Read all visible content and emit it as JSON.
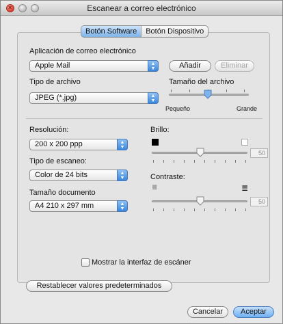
{
  "window": {
    "title": "Escanear a correo electrónico"
  },
  "tabs": [
    {
      "label": "Botón Software",
      "active": true
    },
    {
      "label": "Botón Dispositivo",
      "active": false
    }
  ],
  "email_app": {
    "label": "Aplicación de correo electrónico",
    "value": "Apple Mail",
    "add_label": "Añadir",
    "remove_label": "Eliminar"
  },
  "file_type": {
    "label": "Tipo de archivo",
    "value": "JPEG (*.jpg)"
  },
  "file_size": {
    "label": "Tamaño del archivo",
    "min_label": "Pequeño",
    "max_label": "Grande"
  },
  "resolution": {
    "label": "Resolución:",
    "value": "200 x 200 ppp"
  },
  "scan_type": {
    "label": "Tipo de escaneo:",
    "value": "Color de 24 bits"
  },
  "doc_size": {
    "label": "Tamaño documento",
    "value": "A4  210 x 297 mm"
  },
  "brightness": {
    "label": "Brillo:",
    "value": "50"
  },
  "contrast": {
    "label": "Contraste:",
    "value": "50"
  },
  "show_interface": {
    "label": "Mostrar la interfaz de escáner",
    "checked": false
  },
  "restore_defaults_label": "Restablecer valores predeterminados",
  "footer": {
    "cancel_label": "Cancelar",
    "accept_label": "Aceptar"
  },
  "colors": {
    "accent": "#5fa8f0",
    "window_bg": "#e8e8e8"
  }
}
